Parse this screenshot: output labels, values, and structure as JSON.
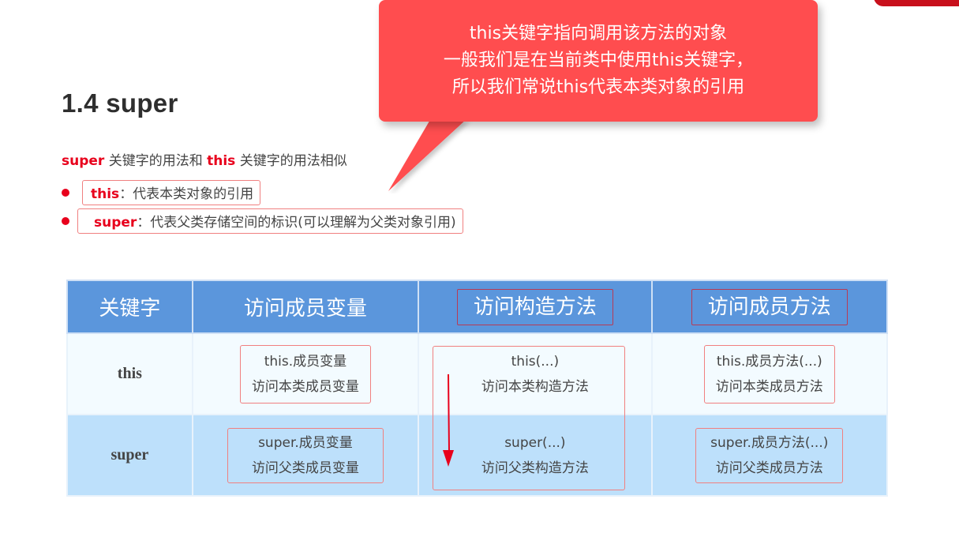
{
  "slide": {
    "title": "1.4 super",
    "intro": {
      "kw1": "super",
      "text1": " 关键字的用法和 ",
      "kw2": "this",
      "text2": " 关键字的用法相似"
    },
    "bullets": [
      {
        "kw": "this",
        "text": "：代表本类对象的引用"
      },
      {
        "kw": "super",
        "text": "：代表父类存储空间的标识(可以理解为父类对象引用)"
      }
    ]
  },
  "callout": {
    "lines": [
      "this关键字指向调用该方法的对象",
      "一般我们是在当前类中使用this关键字，",
      "所以我们常说this代表本类对象的引用"
    ]
  },
  "table": {
    "headers": [
      "关键字",
      "访问成员变量",
      "访问构造方法",
      "访问成员方法"
    ],
    "rows": [
      {
        "keyword": "this",
        "field": [
          "this.成员变量",
          "访问本类成员变量"
        ],
        "ctor": [
          "this(...)",
          "访问本类构造方法"
        ],
        "method": [
          "this.成员方法(...)",
          "访问本类成员方法"
        ]
      },
      {
        "keyword": "super",
        "field": [
          "super.成员变量",
          "访问父类成员变量"
        ],
        "ctor": [
          "super(...)",
          "访问父类构造方法"
        ],
        "method": [
          "super.成员方法(...)",
          "访问父类成员方法"
        ]
      }
    ]
  },
  "colors": {
    "accent_red": "#e8001c",
    "callout_bg": "#ff4d4f",
    "header_bg": "#5b96dc",
    "row1_bg": "#f3fbff",
    "row2_bg": "#bde0fb"
  }
}
